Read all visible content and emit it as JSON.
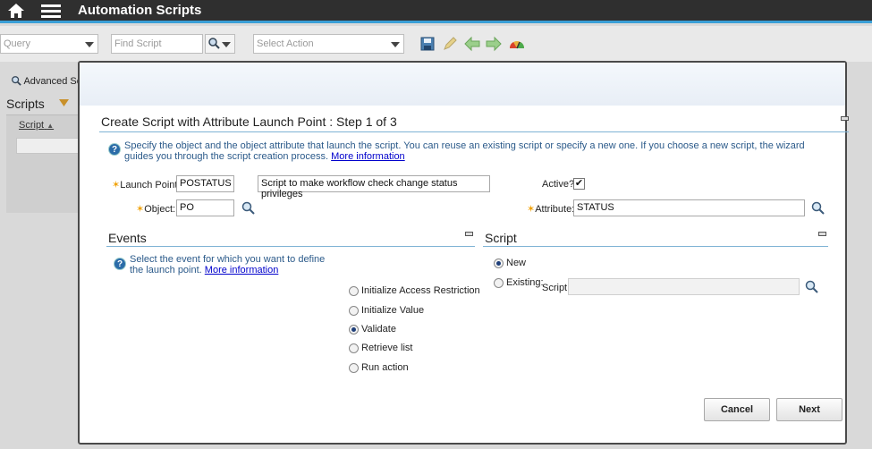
{
  "app": {
    "title": "Automation Scripts"
  },
  "toolbar": {
    "query_placeholder": "Query",
    "find_placeholder": "Find Script",
    "action_placeholder": "Select Action"
  },
  "background": {
    "advanced_search": "Advanced Se",
    "list_title": "Scripts",
    "column_script": "Script"
  },
  "dialog": {
    "title": "Create Script with Attribute Launch Point : Step 1 of 3",
    "intro": "Specify the object and the object attribute that launch the script. You can reuse an existing script or specify a new one. If you choose a new script, the wizard guides you through the script creation process.",
    "more_info": "More information",
    "launch_point_label": "Launch Point:",
    "launch_point_value": "POSTATUS",
    "description_value": "Script to make workflow check change status privileges",
    "active_label": "Active?",
    "active_mark": "✔",
    "object_label": "Object:",
    "object_value": "PO",
    "attribute_label": "Attribute:",
    "attribute_value": "STATUS",
    "events": {
      "title": "Events",
      "info": "Select the event for which you want to define the launch point.",
      "more_info": "More information",
      "options": [
        {
          "label": "Initialize Access Restriction",
          "selected": false
        },
        {
          "label": "Initialize Value",
          "selected": false
        },
        {
          "label": "Validate",
          "selected": true
        },
        {
          "label": "Retrieve list",
          "selected": false
        },
        {
          "label": "Run action",
          "selected": false
        }
      ]
    },
    "script": {
      "title": "Script",
      "new_label": "New",
      "existing_label": "Existing:",
      "script_field_label": "Script:",
      "script_field_value": ""
    },
    "cancel_label": "Cancel",
    "next_label": "Next"
  },
  "colors": {
    "accent": "#3a9fd6",
    "link": "#0000cc",
    "required": "#f0a000"
  }
}
